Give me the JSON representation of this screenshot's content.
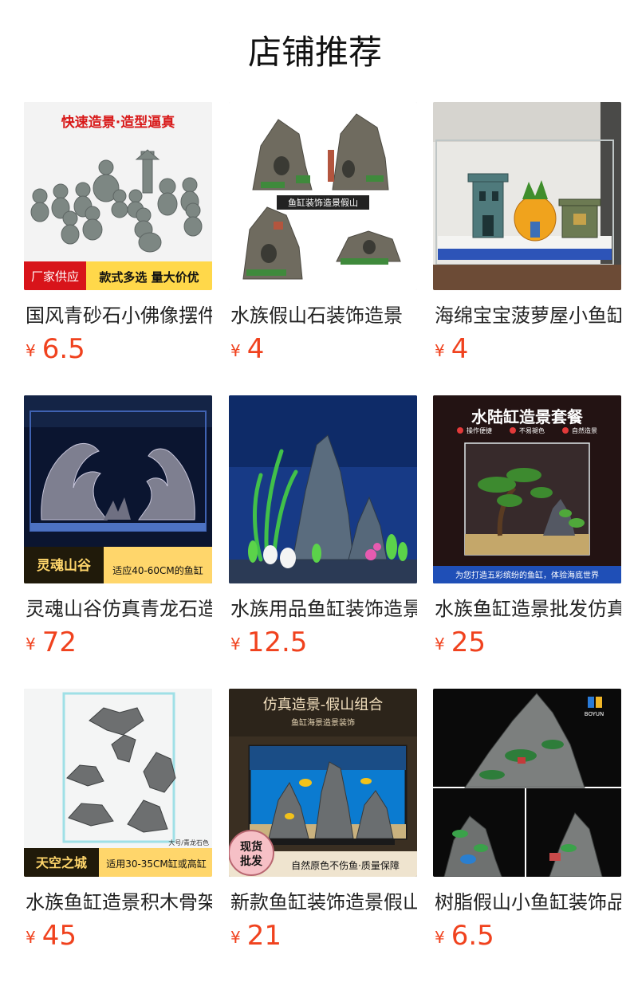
{
  "header": {
    "title": "店铺推荐"
  },
  "currency": "¥",
  "colors": {
    "price": "#f0421e"
  },
  "products": [
    {
      "name": "国风青砂石小佛像摆件",
      "price": "6.5",
      "image": {
        "icon": "buddha-figurines-image",
        "headline": "快速造景·造型逼真",
        "badge": "厂家供应",
        "tagline": "款式多选 量大价优"
      }
    },
    {
      "name": "水族假山石装饰造景",
      "price": "4",
      "image": {
        "icon": "rockery-image",
        "banner": "鱼缸装饰造景假山"
      }
    },
    {
      "name": "海绵宝宝菠萝屋小鱼缸",
      "price": "4",
      "image": {
        "icon": "pineapple-house-tank-image"
      }
    },
    {
      "name": "灵魂山谷仿真青龙石造景",
      "price": "72",
      "image": {
        "icon": "dragon-stone-valley-image",
        "badge": "灵魂山谷",
        "tagline": "适应40-60CM的鱼缸"
      }
    },
    {
      "name": "水族用品鱼缸装饰造景",
      "price": "12.5",
      "image": {
        "icon": "aquarium-plants-image"
      }
    },
    {
      "name": "水族鱼缸造景批发仿真",
      "price": "25",
      "image": {
        "icon": "bonsai-tank-image",
        "headline": "水陆缸造景套餐",
        "features": [
          "操作便捷",
          "不易褪色",
          "自然造景"
        ],
        "tagline": "为您打造五彩缤纷的鱼缸，体验海底世界"
      }
    },
    {
      "name": "水族鱼缸造景积木骨架",
      "price": "45",
      "image": {
        "icon": "floating-rocks-image",
        "badge": "天空之城",
        "tagline": "适用30-35CM缸或高缸",
        "note": "大号/青龙石色"
      }
    },
    {
      "name": "新款鱼缸装饰造景假山",
      "price": "21",
      "image": {
        "icon": "rockery-combo-image",
        "headline": "仿真造景-假山组合",
        "subheadline": "鱼缸海景造景装饰",
        "badge_line1": "现货",
        "badge_line2": "批发",
        "tagline": "自然原色不伤鱼·质量保障"
      }
    },
    {
      "name": "树脂假山小鱼缸装饰品",
      "price": "6.5",
      "image": {
        "icon": "resin-rockery-image",
        "logo_text": "BOYUN"
      }
    }
  ]
}
